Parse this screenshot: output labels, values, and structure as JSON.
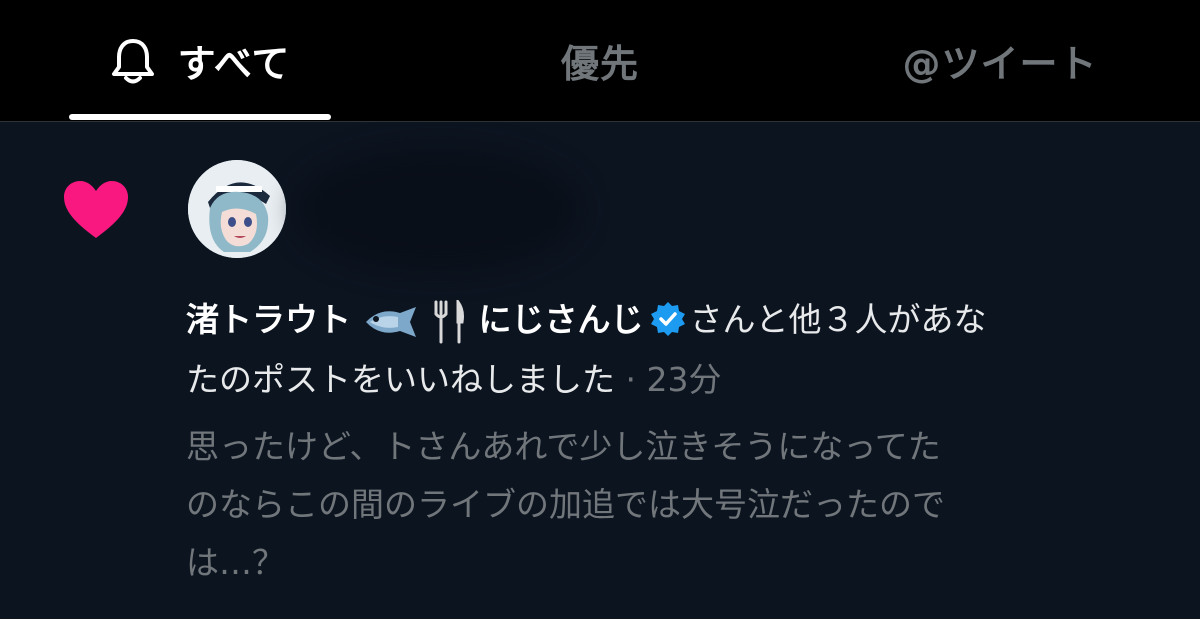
{
  "tabs": [
    {
      "label": "すべて",
      "icon": "bell-icon",
      "active": true
    },
    {
      "label": "優先",
      "active": false
    },
    {
      "label": "@ツイート",
      "active": false
    }
  ],
  "notification": {
    "icon": "heart-icon",
    "icon_color": "#f91880",
    "user_name": "渚トラウト",
    "user_emoji": [
      "fish-icon",
      "fork-knife-icon"
    ],
    "user_affiliation": "にじさんじ",
    "verified_color": "#1d9bf0",
    "action_line1": "さんと他３人があな",
    "action_line2": "たのポストをいいねしました",
    "separator": " · ",
    "time": "23分",
    "preview_lines": [
      "思ったけど、トさんあれで少し泣きそうになってた",
      "のならこの間のライブの加追では大号泣だったので",
      "は…？"
    ]
  }
}
